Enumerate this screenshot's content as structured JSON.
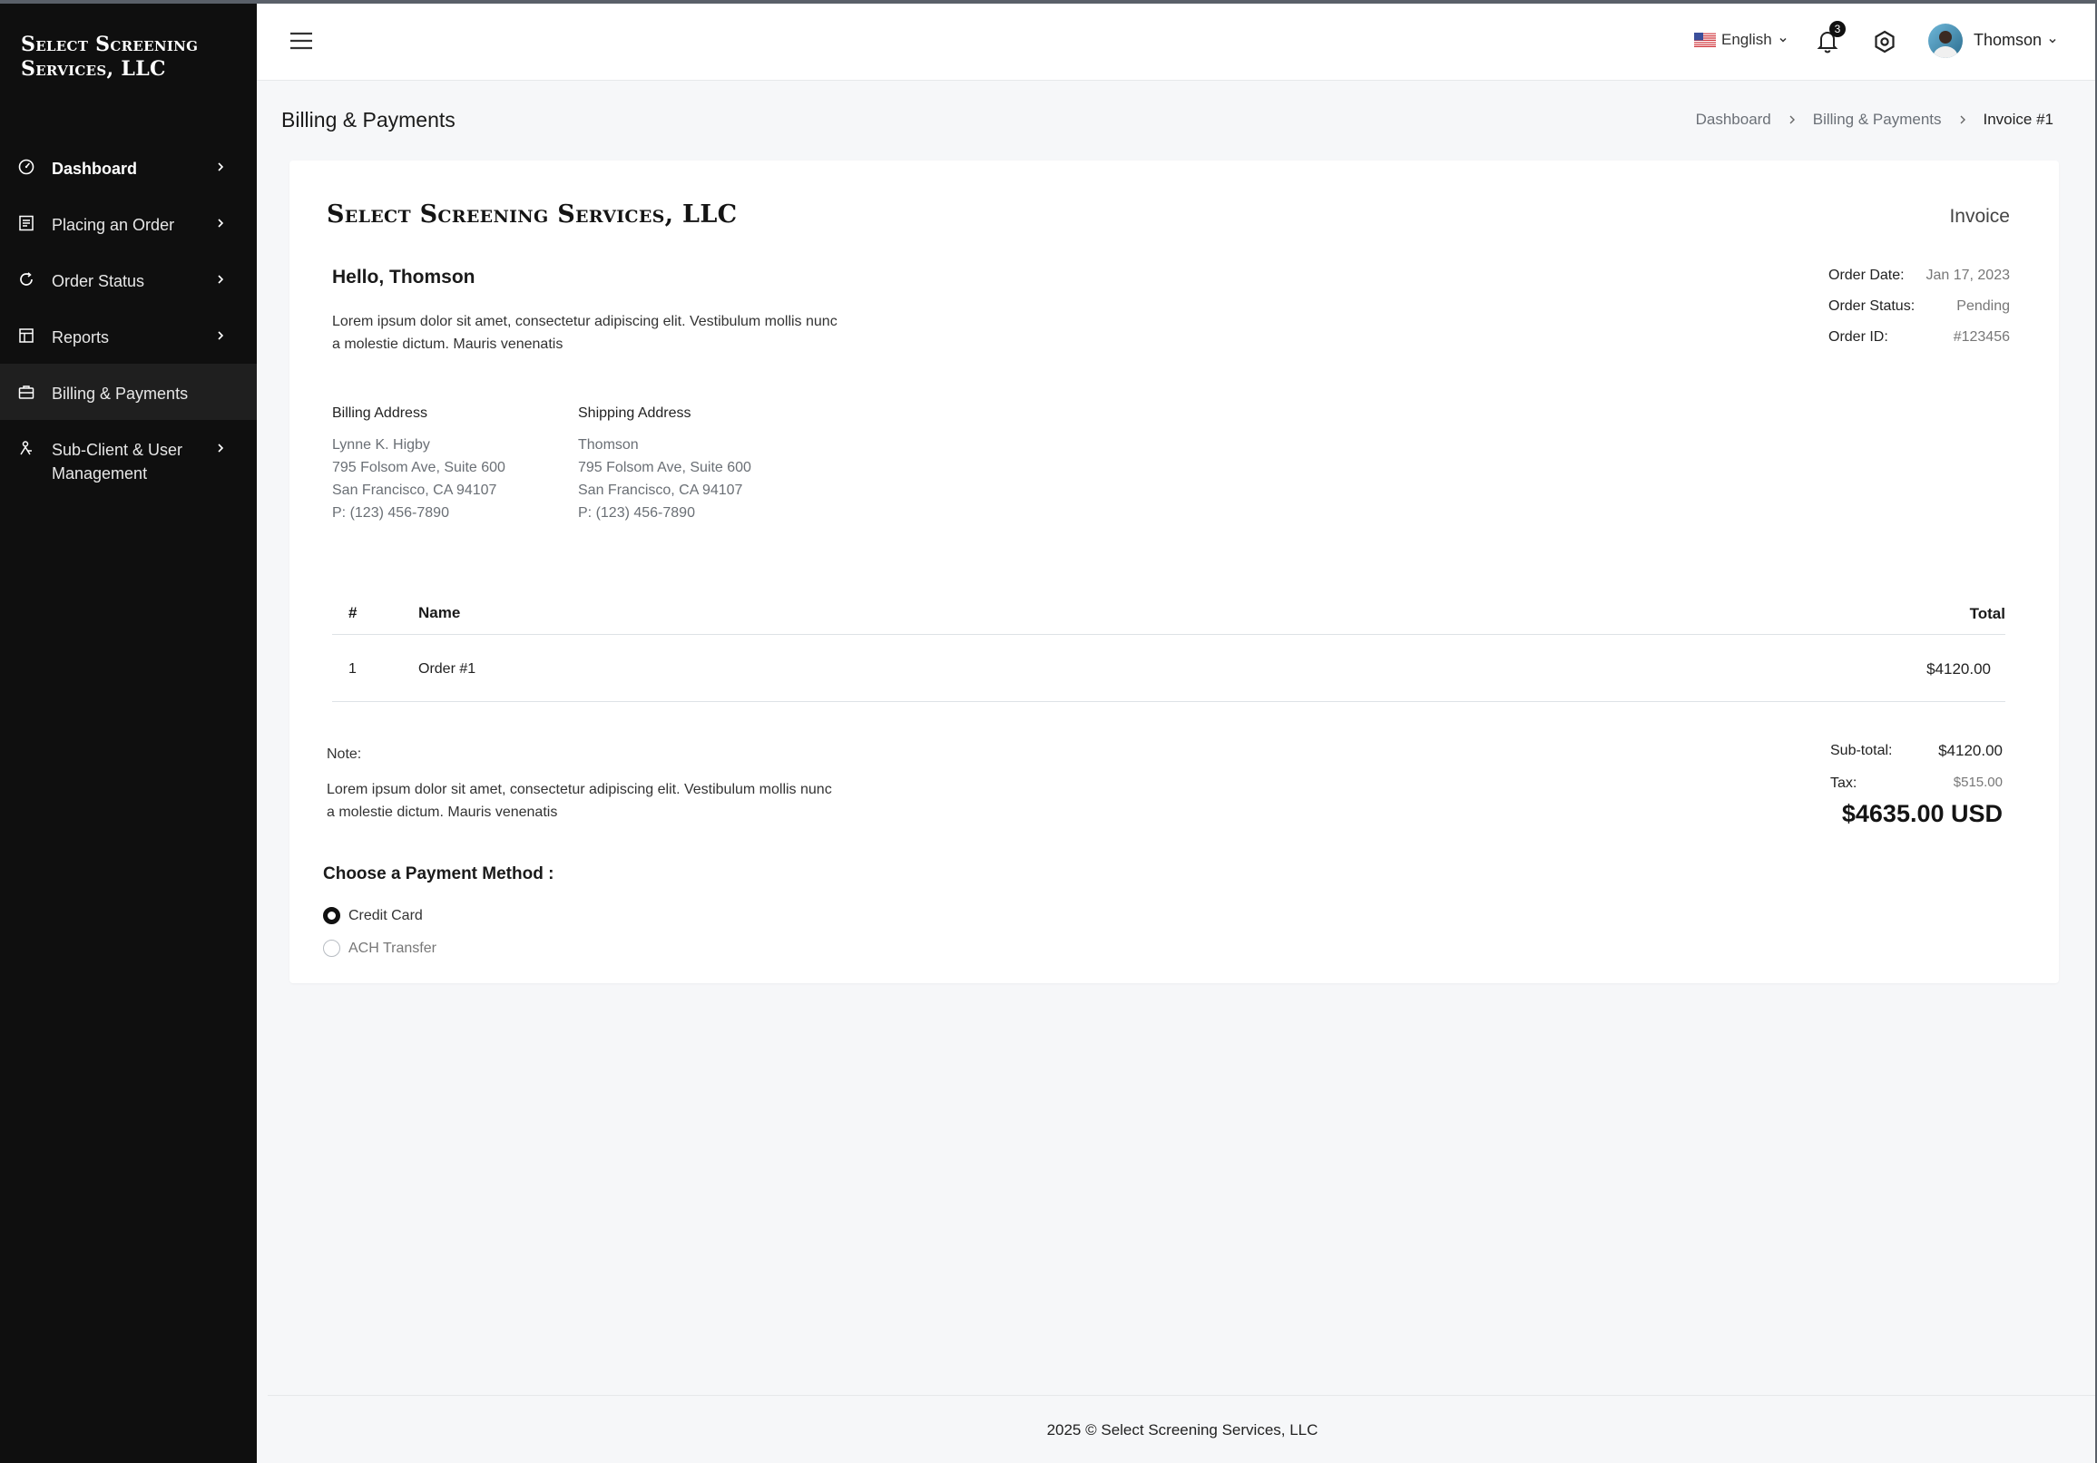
{
  "sidebar": {
    "brand": "Select Screening Services, LLC",
    "items": [
      {
        "label": "Dashboard",
        "icon": "gauge-icon"
      },
      {
        "label": "Placing an Order",
        "icon": "order-form-icon"
      },
      {
        "label": "Order Status",
        "icon": "refresh-icon"
      },
      {
        "label": "Reports",
        "icon": "report-icon"
      },
      {
        "label": "Billing & Payments",
        "icon": "briefcase-icon"
      },
      {
        "label": "Sub-Client & User Management",
        "icon": "user-management-icon"
      }
    ],
    "active_item": "Billing & Payments"
  },
  "topbar": {
    "language": "English",
    "notification_count": "3",
    "user_name": "Thomson"
  },
  "page": {
    "title": "Billing & Payments",
    "breadcrumb": [
      "Dashboard",
      "Billing & Payments",
      "Invoice #1"
    ]
  },
  "invoice": {
    "company": "Select Screening Services, LLC",
    "doc_type": "Invoice",
    "greeting": "Hello, Thomson",
    "intro": "Lorem ipsum dolor sit amet, consectetur adipiscing elit. Vestibulum mollis nunc a molestie dictum. Mauris venenatis",
    "meta": {
      "order_date_label": "Order Date:",
      "order_date": "Jan 17, 2023",
      "order_status_label": "Order Status:",
      "order_status": "Pending",
      "order_id_label": "Order ID:",
      "order_id": "#123456"
    },
    "billing": {
      "heading": "Billing Address",
      "lines": [
        "Lynne K. Higby",
        "795 Folsom Ave, Suite 600",
        "San Francisco, CA 94107",
        "P: (123) 456-7890"
      ]
    },
    "shipping": {
      "heading": "Shipping Address",
      "lines": [
        "Thomson",
        "795 Folsom Ave, Suite 600",
        "San Francisco, CA 94107",
        "P: (123) 456-7890"
      ]
    },
    "table": {
      "headers": {
        "num": "#",
        "name": "Name",
        "total": "Total"
      },
      "rows": [
        {
          "num": "1",
          "name": "Order #1",
          "total": "$4120.00"
        }
      ]
    },
    "note_label": "Note:",
    "note": "Lorem ipsum dolor sit amet, consectetur adipiscing elit. Vestibulum mollis nunc a molestie dictum. Mauris venenatis",
    "subtotal_label": "Sub-total:",
    "subtotal": "$4120.00",
    "tax_label": "Tax:",
    "tax": "$515.00",
    "grand_total": "$4635.00 USD",
    "payment_title": "Choose a Payment Method :",
    "payment_options": [
      "Credit Card",
      "ACH Transfer"
    ],
    "selected_payment": "Credit Card"
  },
  "footer": {
    "text": "2025 © Select Screening Services, LLC"
  }
}
